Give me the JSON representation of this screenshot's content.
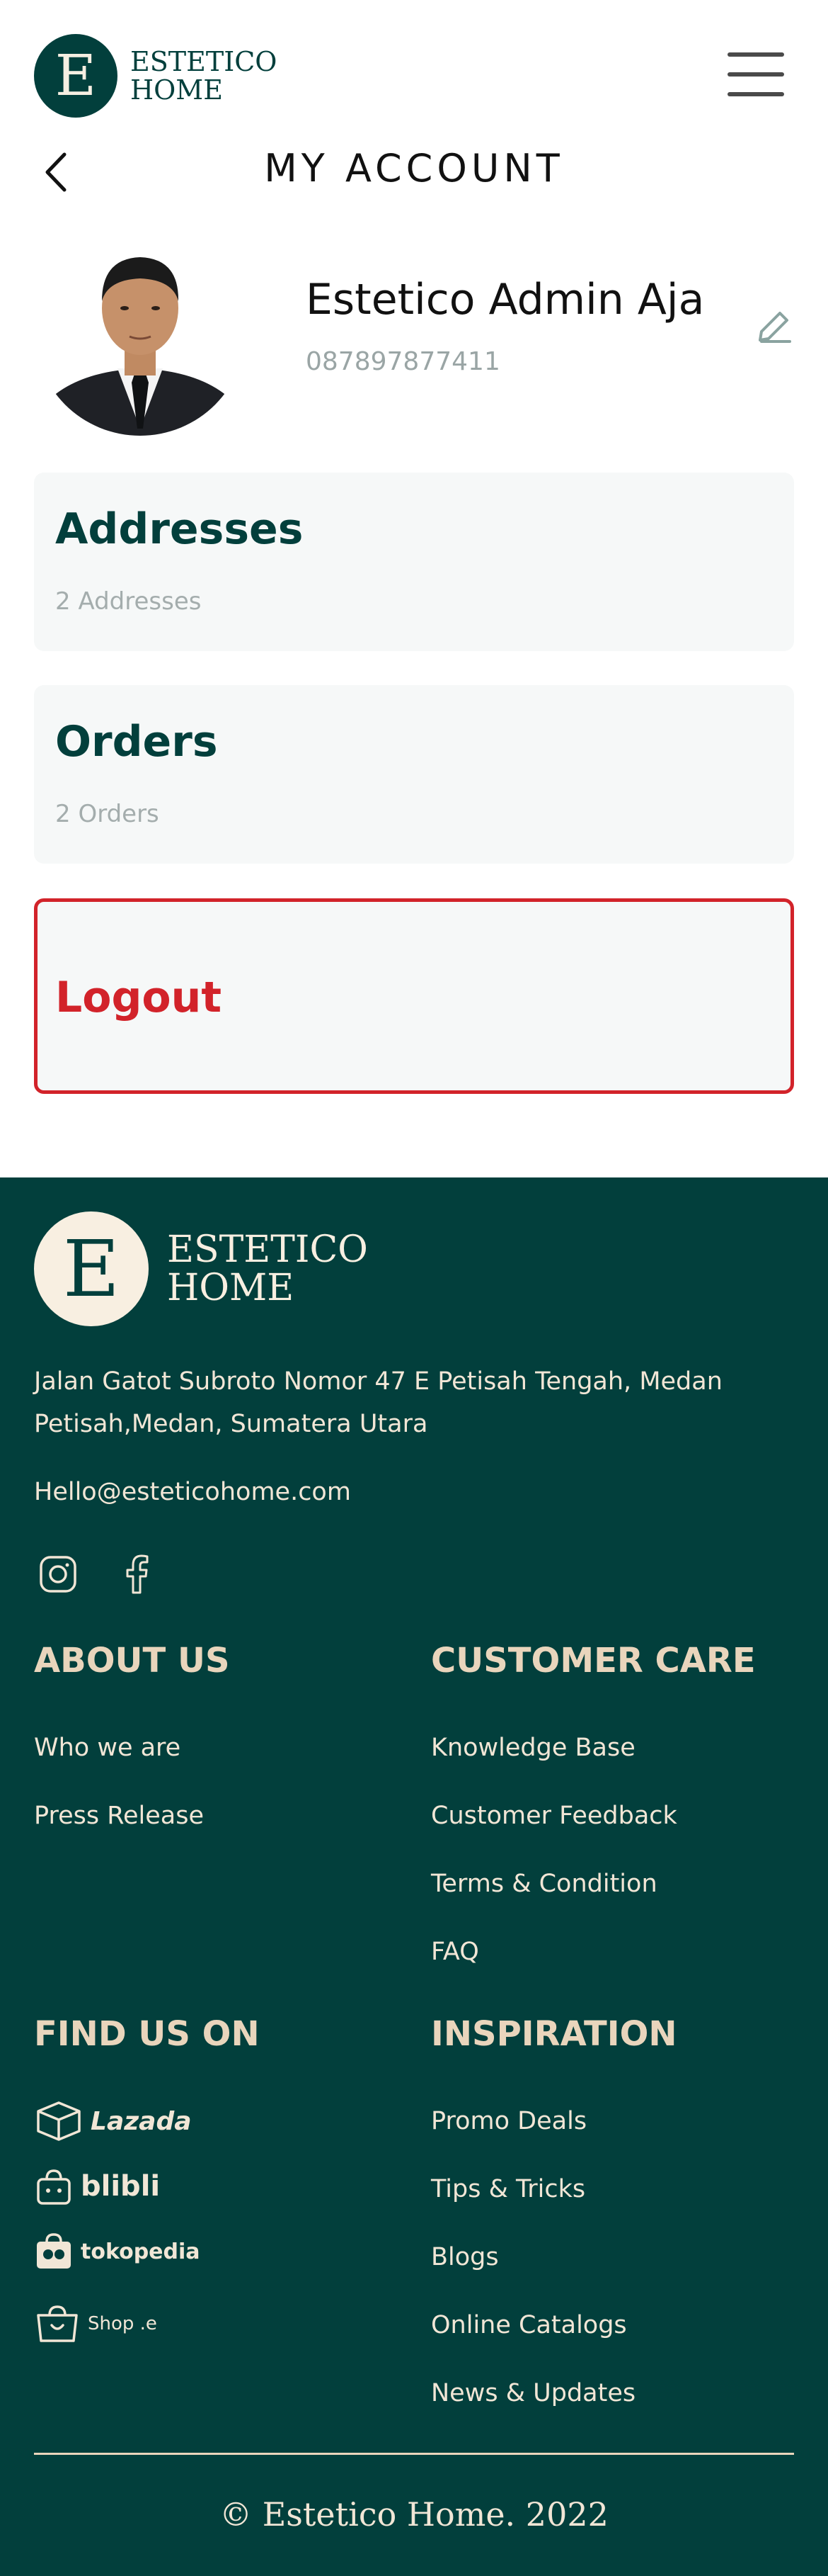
{
  "header": {
    "logo_mark": "E",
    "logo_line1": "ESTETICO",
    "logo_line2": "HOME",
    "menu_icon": "hamburger-menu-icon"
  },
  "page": {
    "title": "MY ACCOUNT",
    "back_icon": "chevron-left-icon"
  },
  "profile": {
    "name": "Estetico Admin Aja",
    "phone": "087897877411",
    "edit_icon": "pencil-icon"
  },
  "cards": {
    "addresses": {
      "title": "Addresses",
      "subtitle": "2 Addresses"
    },
    "orders": {
      "title": "Orders",
      "subtitle": "2 Orders"
    },
    "logout": {
      "title": "Logout"
    }
  },
  "footer": {
    "logo_mark": "E",
    "logo_line1": "ESTETICO",
    "logo_line2": "HOME",
    "address_line1": "Jalan Gatot Subroto Nomor 47 E Petisah Tengah, Medan",
    "address_line2": "Petisah,Medan, Sumatera Utara",
    "email": "Hello@esteticohome.com",
    "social": [
      "instagram-icon",
      "facebook-icon"
    ],
    "about": {
      "heading": "ABOUT US",
      "links": [
        "Who we are",
        "Press Release"
      ]
    },
    "customer_care": {
      "heading": "CUSTOMER CARE",
      "links": [
        "Knowledge Base",
        "Customer Feedback",
        "Terms & Condition",
        "FAQ"
      ]
    },
    "find_us": {
      "heading": "FIND US ON",
      "stores": [
        "Lazada",
        "blibli",
        "tokopedia",
        "Shop .e"
      ]
    },
    "inspiration": {
      "heading": "INSPIRATION",
      "links": [
        "Promo Deals",
        "Tips & Tricks",
        "Blogs",
        "Online Catalogs",
        "News & Updates"
      ]
    },
    "copyright": "© Estetico Home. 2022"
  },
  "colors": {
    "brand_green": "#023f3c",
    "cream": "#f1e6d6",
    "danger": "#d2232a",
    "muted": "#9aa5a5"
  }
}
